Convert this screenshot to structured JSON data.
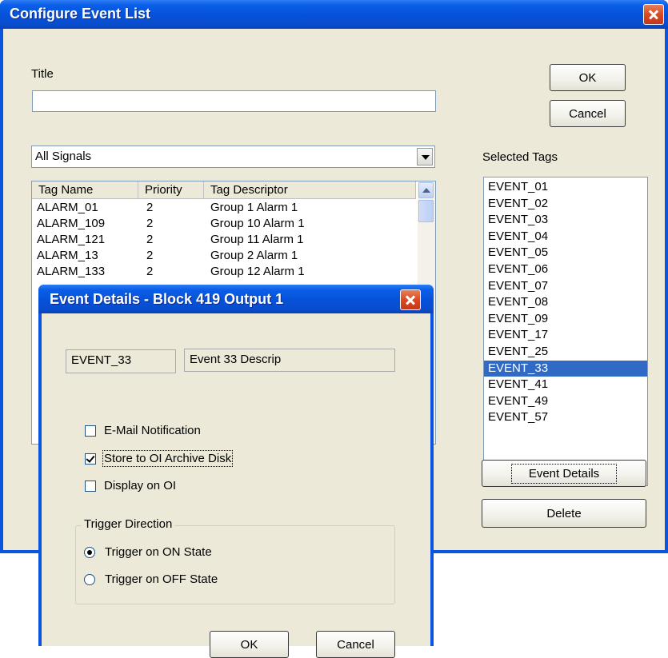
{
  "main": {
    "title": "Configure Event List",
    "title_label": "Title",
    "title_value": "",
    "ok_label": "OK",
    "cancel_label": "Cancel",
    "signal_filter": "All Signals",
    "columns": [
      "Tag Name",
      "Priority",
      "Tag Descriptor"
    ],
    "rows": [
      {
        "name": "ALARM_01",
        "priority": "2",
        "descriptor": "Group 1 Alarm 1"
      },
      {
        "name": "ALARM_109",
        "priority": "2",
        "descriptor": "Group 10 Alarm 1"
      },
      {
        "name": "ALARM_121",
        "priority": "2",
        "descriptor": "Group 11 Alarm 1"
      },
      {
        "name": "ALARM_13",
        "priority": "2",
        "descriptor": "Group 2 Alarm 1"
      },
      {
        "name": "ALARM_133",
        "priority": "2",
        "descriptor": "Group 12 Alarm 1"
      }
    ],
    "selected_tags_label": "Selected Tags",
    "selected_tags": [
      "EVENT_01",
      "EVENT_02",
      "EVENT_03",
      "EVENT_04",
      "EVENT_05",
      "EVENT_06",
      "EVENT_07",
      "EVENT_08",
      "EVENT_09",
      "EVENT_17",
      "EVENT_25",
      "EVENT_33",
      "EVENT_41",
      "EVENT_49",
      "EVENT_57"
    ],
    "selected_tag_active": "EVENT_33",
    "event_details_label": "Event Details",
    "delete_label": "Delete"
  },
  "dialog": {
    "title": "Event Details - Block 419  Output 1",
    "tag_name": "EVENT_33",
    "tag_descriptor": "Event 33 Descrip",
    "options": [
      {
        "label": "E-Mail Notification",
        "checked": false
      },
      {
        "label": "Store to OI Archive Disk",
        "checked": true
      },
      {
        "label": "Display on OI",
        "checked": false
      }
    ],
    "trigger_group_label": "Trigger Direction",
    "triggers": [
      {
        "label": "Trigger on ON State",
        "selected": true
      },
      {
        "label": "Trigger on OFF State",
        "selected": false
      }
    ],
    "ok_label": "OK",
    "cancel_label": "Cancel"
  },
  "colors": {
    "titlebar": "#0a54e0",
    "face": "#ece9d8",
    "selection": "#316ac5",
    "close": "#d84a22"
  },
  "icons": [
    "close-icon",
    "dropdown-arrow-icon",
    "scroll-up-icon"
  ]
}
